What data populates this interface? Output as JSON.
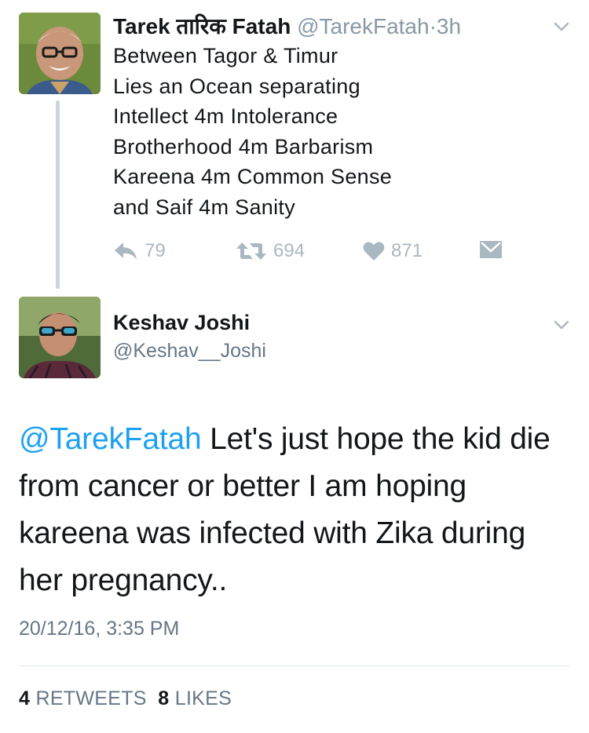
{
  "parent_tweet": {
    "author_name": "Tarek तारिक Fatah",
    "handle": "@TarekFatah",
    "separator": "·",
    "time_ago": "3h",
    "lines": [
      "Between Tagor & Timur",
      "Lies an Ocean separating",
      "Intellect 4m Intolerance",
      "Brotherhood 4m Barbarism",
      "Kareena 4m Common Sense",
      "and Saif 4m Sanity"
    ],
    "actions": {
      "reply_count": "79",
      "retweet_count": "694",
      "like_count": "871"
    }
  },
  "reply_tweet": {
    "author_name": "Keshav Joshi",
    "handle": "@Keshav__Joshi",
    "mention": "@TarekFatah",
    "body_text": " Let's just hope the kid die from cancer or better I am hoping kareena was infected with Zika during her pregnancy..",
    "timestamp": "20/12/16, 3:35 PM",
    "stats": {
      "retweets_count": "4",
      "retweets_label": "RETWEETS",
      "likes_count": "8",
      "likes_label": "LIKES"
    }
  },
  "icons": [
    "reply-icon",
    "retweet-icon",
    "like-icon",
    "direct-message-icon",
    "chevron-down-icon"
  ],
  "colors": {
    "link_blue": "#1da1f2",
    "secondary_text": "#8899a6",
    "action_gray": "#aab8c2",
    "thread_line": "#ccd6dd"
  }
}
